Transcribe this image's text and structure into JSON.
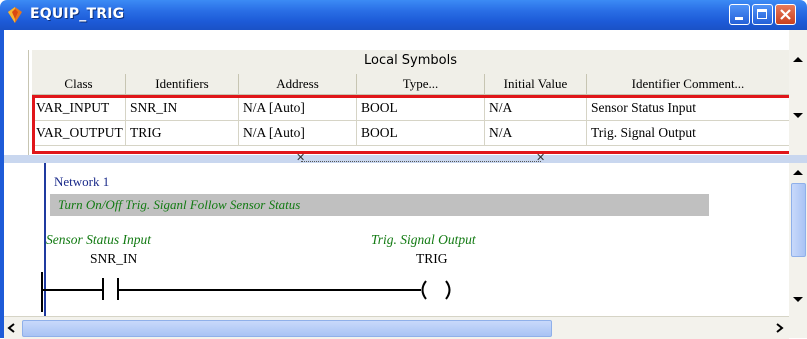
{
  "window": {
    "title": "EQUIP_TRIG",
    "icon": "gem-icon"
  },
  "symbols": {
    "title": "Local Symbols",
    "columns": [
      "Class",
      "Identifiers",
      "Address",
      "Type...",
      "Initial Value",
      "Identifier Comment..."
    ],
    "rows": [
      [
        "VAR_INPUT",
        "SNR_IN",
        "N/A [Auto]",
        "BOOL",
        "N/A",
        "Sensor Status Input"
      ],
      [
        "VAR_OUTPUT",
        "TRIG",
        "N/A [Auto]",
        "BOOL",
        "N/A",
        "Trig. Signal Output"
      ]
    ]
  },
  "ladder": {
    "network_label": "Network 1",
    "network_comment": "Turn On/Off Trig. Siganl Follow Sensor Status",
    "contact": {
      "comment": "Sensor Status Input",
      "identifier": "SNR_IN"
    },
    "coil": {
      "comment": "Trig. Signal Output",
      "identifier": "TRIG"
    }
  },
  "colors": {
    "title_bar": "#2a6fe6",
    "highlight_box": "#e0161a",
    "comment_text": "#127a12",
    "comment_band": "#c0c0c0"
  }
}
